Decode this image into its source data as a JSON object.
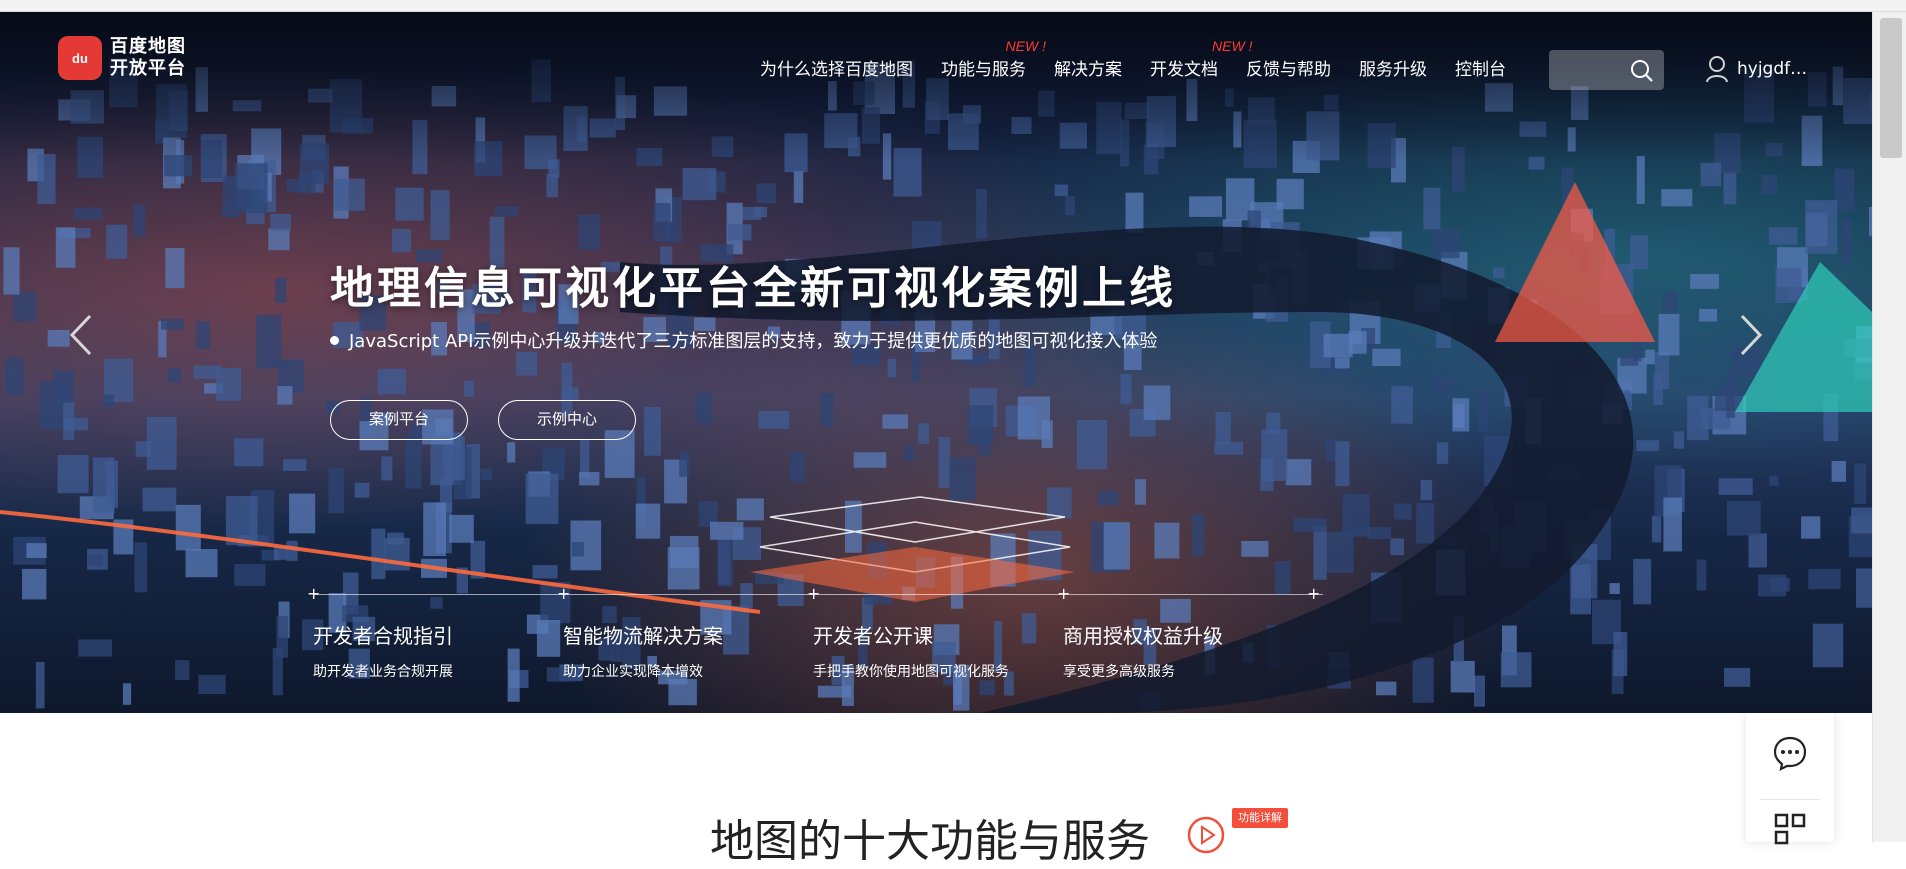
{
  "header": {
    "logo_mark": "du",
    "logo_line1": "百度地图",
    "logo_line2": "开放平台",
    "nav": [
      {
        "label": "为什么选择百度地图",
        "badge": ""
      },
      {
        "label": "功能与服务",
        "badge": "NEW !"
      },
      {
        "label": "解决方案",
        "badge": ""
      },
      {
        "label": "开发文档",
        "badge": ""
      },
      {
        "label": "反馈与帮助",
        "badge": "NEW !"
      },
      {
        "label": "服务升级",
        "badge": ""
      },
      {
        "label": "控制台",
        "badge": ""
      }
    ],
    "search_placeholder": "",
    "username": "hyjgdf…"
  },
  "hero": {
    "title": "地理信息可视化平台全新可视化案例上线",
    "subtitle": "JavaScript API示例中心升级并迭代了三方标准图层的支持，致力于提供更优质的地图可视化接入体验",
    "button_cases": "案例平台",
    "button_examples": "示例中心"
  },
  "features": [
    {
      "title": "开发者合规指引",
      "desc": "助开发者业务合规开展"
    },
    {
      "title": "智能物流解决方案",
      "desc": "助力企业实现降本增效"
    },
    {
      "title": "开发者公开课",
      "desc": "手把手教你使用地图可视化服务"
    },
    {
      "title": "商用授权权益升级",
      "desc": "享受更多高级服务"
    }
  ],
  "section": {
    "title": "地图的十大功能与服务",
    "detail_badge": "功能详解"
  },
  "colors": {
    "accent_red": "#e53935",
    "badge_red": "#ff3b30",
    "hero_dark": "#0d1730"
  },
  "icons": [
    "search-icon",
    "user-icon",
    "chevron-left-icon",
    "chevron-right-icon",
    "play-icon",
    "chat-icon",
    "qr-code-icon"
  ]
}
